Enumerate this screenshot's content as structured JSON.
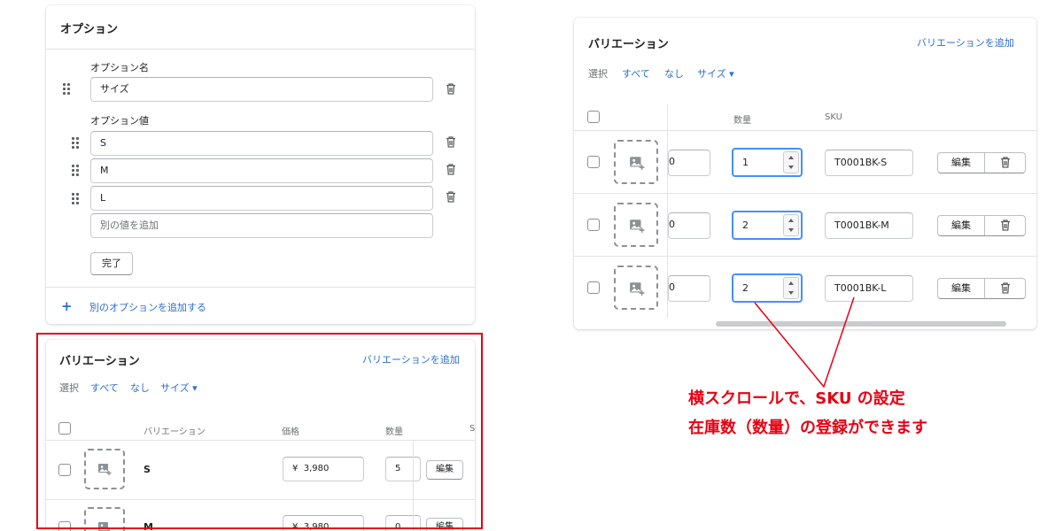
{
  "options_card": {
    "title": "オプション",
    "option_name_label": "オプション名",
    "option_name_value": "サイズ",
    "option_values_label": "オプション値",
    "values": [
      "S",
      "M",
      "L"
    ],
    "add_value_placeholder": "別の値を追加",
    "done_button": "完了",
    "add_option_plus": "+",
    "add_option_link": "別のオプションを追加する"
  },
  "variations_right": {
    "title": "バリエーション",
    "add_link": "バリエーションを追加",
    "select_label": "選択",
    "select_all": "すべて",
    "select_none": "なし",
    "select_size": "サイズ",
    "dropdown_arrow": "▾",
    "col_quantity": "数量",
    "col_sku": "SKU",
    "rows": [
      {
        "price_clip": "0",
        "quantity": "1",
        "sku": "T0001BK-S",
        "edit": "編集"
      },
      {
        "price_clip": "0",
        "quantity": "2",
        "sku": "T0001BK-M",
        "edit": "編集"
      },
      {
        "price_clip": "0",
        "quantity": "2",
        "sku": "T0001BK-L",
        "edit": "編集"
      }
    ]
  },
  "variations_left": {
    "title": "バリエーション",
    "add_link": "バリエーションを追加",
    "select_label": "選択",
    "select_all": "すべて",
    "select_none": "なし",
    "select_size": "サイズ",
    "dropdown_arrow": "▾",
    "col_variation": "バリエーション",
    "col_price": "価格",
    "col_quantity": "数量",
    "col_sku_clip": "S",
    "rows": [
      {
        "name": "S",
        "price": "¥  3,980",
        "quantity": "5",
        "edit": "編集"
      },
      {
        "name": "M",
        "price": "¥  3,980",
        "quantity": "0",
        "edit": "編集"
      }
    ]
  },
  "annotation": {
    "line1": "横スクロールで、SKU の設定",
    "line2": "在庫数（数量）の登録ができます"
  },
  "colors": {
    "link": "#2c6ecb",
    "annotation_red": "#e60012",
    "focus_blue": "#458fff",
    "highlight_border": "#e60012"
  }
}
